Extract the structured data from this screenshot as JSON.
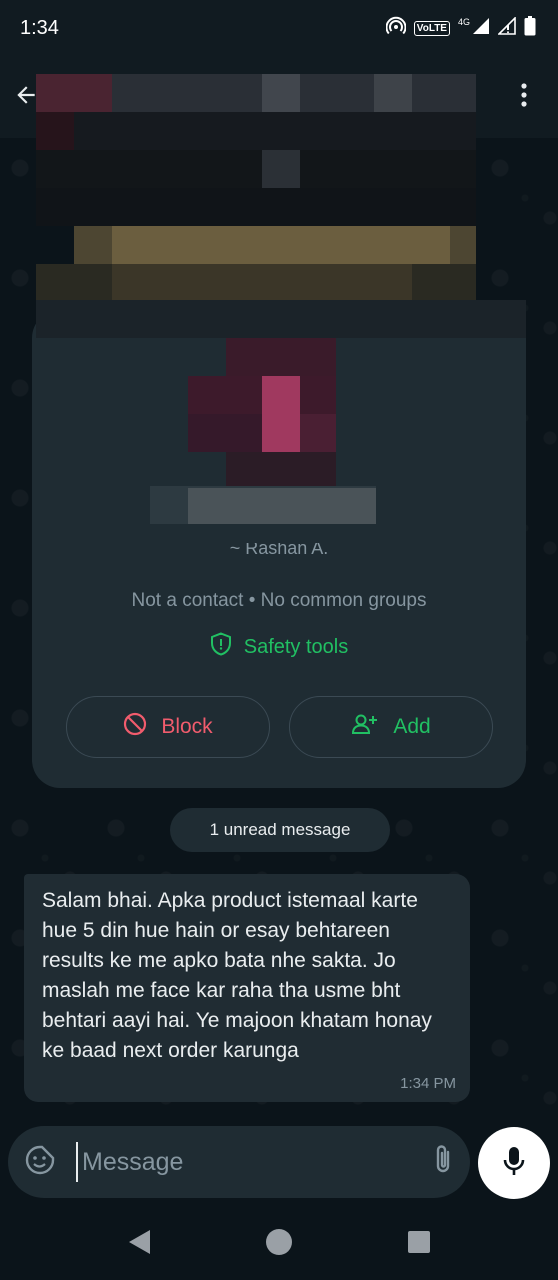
{
  "status_bar": {
    "time": "1:34",
    "volte_label": "VoLTE",
    "network_label": "4G"
  },
  "header": {
    "contact_name": "",
    "menu_icon": "more-vertical-icon",
    "back_icon": "arrow-left-icon"
  },
  "contact_card": {
    "pushname": "~ Rashan A.",
    "subtitle": "Not a contact • No common groups",
    "safety_label": "Safety tools",
    "block_label": "Block",
    "add_label": "Add"
  },
  "unread_label": "1 unread message",
  "message": {
    "text": "Salam bhai. Apka product istemaal karte hue 5 din hue hain or esay behtareen results ke me apko bata nhe sakta. Jo maslah me face kar raha tha usme bht behtari aayi hai. Ye majoon khatam honay ke baad next order karunga",
    "time": "1:34 PM"
  },
  "composer": {
    "placeholder": "Message"
  },
  "colors": {
    "accent_green": "#21c063",
    "danger_red": "#f15c6d",
    "bubble": "#202c33",
    "background": "#0b141a"
  }
}
